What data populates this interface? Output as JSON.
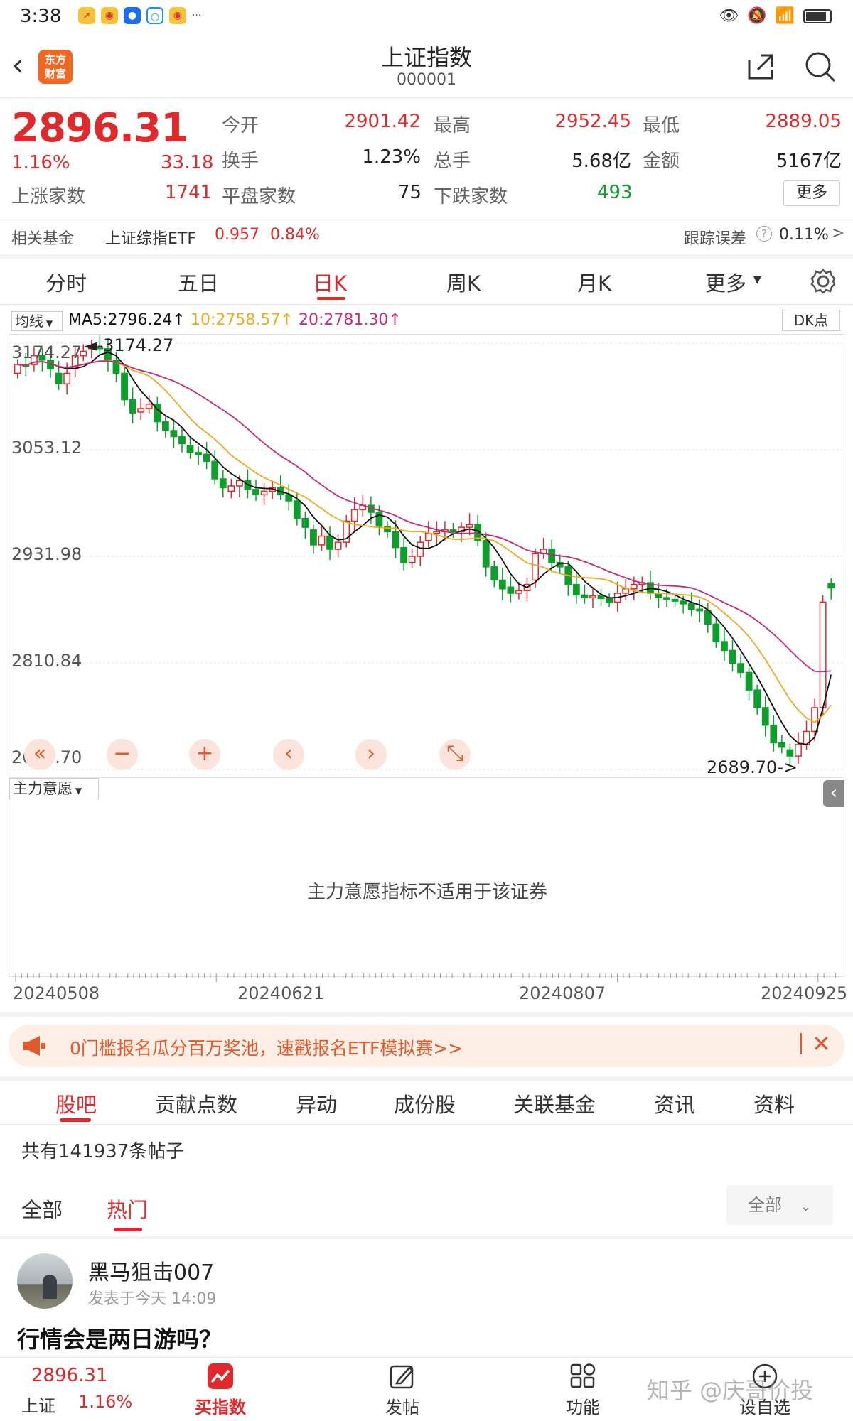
{
  "status_bar": {
    "time": "3:38",
    "dots": "···"
  },
  "header": {
    "title": "上证指数",
    "code": "000001",
    "logo_text": "东方\n财富"
  },
  "quote": {
    "price": "2896.31",
    "change_pct": "1.16%",
    "change": "33.18",
    "rows": [
      [
        {
          "label": "今开",
          "value": "2901.42",
          "color": "red"
        },
        {
          "label": "最高",
          "value": "2952.45",
          "color": "red"
        },
        {
          "label": "最低",
          "value": "2889.05",
          "color": "red"
        }
      ],
      [
        {
          "label": "换手",
          "value": "1.23%",
          "color": "black"
        },
        {
          "label": "总手",
          "value": "5.68亿",
          "color": "black"
        },
        {
          "label": "金额",
          "value": "5167亿",
          "color": "black"
        }
      ]
    ],
    "breadth": {
      "up_label": "上涨家数",
      "up": "1741",
      "flat_label": "平盘家数",
      "flat": "75",
      "down_label": "下跌家数",
      "down": "493"
    },
    "more_label": "更多"
  },
  "fund_row": {
    "label": "相关基金",
    "name": "上证综指ETF",
    "price": "0.957",
    "pct": "0.84%",
    "track_label": "跟踪误差",
    "track_value": "0.11%",
    "arrow": ">"
  },
  "ktabs": [
    "分时",
    "五日",
    "日K",
    "周K",
    "月K",
    "更多"
  ],
  "ktabs_active": 2,
  "ma": {
    "selector": "均线",
    "ma5": "MA5:2796.24",
    "ma10": "10:2758.57",
    "ma20": "20:2781.30",
    "dk": "DK点"
  },
  "chart_data": {
    "type": "candlestick",
    "y_ticks": [
      "3174.27",
      "3053.12",
      "2931.98",
      "2810.84",
      "2689.70"
    ],
    "ylim": [
      2689.7,
      3174.27
    ],
    "high_label": "3174.27",
    "low_label": "2689.70",
    "x_ticks": [
      "20240508",
      "20240621",
      "20240807",
      "20240925"
    ],
    "series": [
      {
        "name": "MA5",
        "color": "#111111"
      },
      {
        "name": "MA10",
        "color": "#f0a81e"
      },
      {
        "name": "MA20",
        "color": "#c8287a"
      }
    ],
    "closes": [
      3150,
      3148,
      3160,
      3155,
      3145,
      3128,
      3140,
      3160,
      3165,
      3172,
      3168,
      3155,
      3140,
      3110,
      3095,
      3100,
      3105,
      3085,
      3075,
      3068,
      3060,
      3050,
      3048,
      3040,
      3020,
      3010,
      3012,
      3018,
      3008,
      3002,
      3006,
      3010,
      3002,
      2995,
      2975,
      2965,
      2945,
      2955,
      2940,
      2948,
      2972,
      2985,
      2990,
      2982,
      2966,
      2960,
      2942,
      2925,
      2932,
      2948,
      2958,
      2960,
      2962,
      2960,
      2965,
      2968,
      2950,
      2920,
      2905,
      2895,
      2890,
      2893,
      2900,
      2935,
      2940,
      2925,
      2920,
      2900,
      2888,
      2885,
      2887,
      2884,
      2880,
      2890,
      2895,
      2900,
      2902,
      2890,
      2885,
      2883,
      2881,
      2878,
      2872,
      2870,
      2855,
      2835,
      2825,
      2810,
      2800,
      2780,
      2760,
      2740,
      2720,
      2715,
      2705,
      2718,
      2733,
      2760,
      2880,
      2896
    ],
    "opens": [
      3140,
      3150,
      3150,
      3160,
      3155,
      3140,
      3128,
      3145,
      3160,
      3168,
      3170,
      3168,
      3155,
      3140,
      3110,
      3096,
      3100,
      3105,
      3085,
      3075,
      3068,
      3058,
      3050,
      3048,
      3040,
      3020,
      3006,
      3012,
      3018,
      3008,
      3002,
      3006,
      3010,
      3002,
      2995,
      2975,
      2962,
      2945,
      2955,
      2940,
      2948,
      2972,
      2985,
      2990,
      2982,
      2966,
      2960,
      2942,
      2925,
      2932,
      2950,
      2958,
      2960,
      2962,
      2960,
      2965,
      2968,
      2950,
      2920,
      2905,
      2897,
      2890,
      2893,
      2905,
      2935,
      2940,
      2925,
      2920,
      2900,
      2888,
      2885,
      2887,
      2884,
      2880,
      2890,
      2895,
      2900,
      2902,
      2890,
      2885,
      2883,
      2881,
      2878,
      2872,
      2870,
      2855,
      2835,
      2825,
      2810,
      2800,
      2780,
      2760,
      2740,
      2720,
      2712,
      2705,
      2718,
      2733,
      2760,
      2901
    ]
  },
  "controls": [
    "«",
    "−",
    "+",
    "‹",
    "›",
    "⤡"
  ],
  "indicator": {
    "selector": "主力意愿",
    "message": "主力意愿指标不适用于该证券"
  },
  "banner": {
    "text": "0门槛报名瓜分百万奖池，速戳报名ETF模拟赛>>"
  },
  "section_tabs": [
    "股吧",
    "贡献点数",
    "异动",
    "成份股",
    "关联基金",
    "资讯",
    "资料"
  ],
  "section_active": 0,
  "posts": {
    "count_text": "共有141937条帖子",
    "filters": [
      "全部",
      "热门"
    ],
    "filter_active": 1,
    "dropdown": "全部"
  },
  "post": {
    "author": "黑马狙击007",
    "time": "发表于今天 14:09",
    "title": "行情会是两日游吗？"
  },
  "bottom_nav": {
    "price": "2896.31",
    "name": "上证",
    "pct": "1.16%",
    "items": [
      "买指数",
      "发帖",
      "功能",
      "设自选"
    ]
  },
  "watermark": "知乎 @庆哥价投"
}
